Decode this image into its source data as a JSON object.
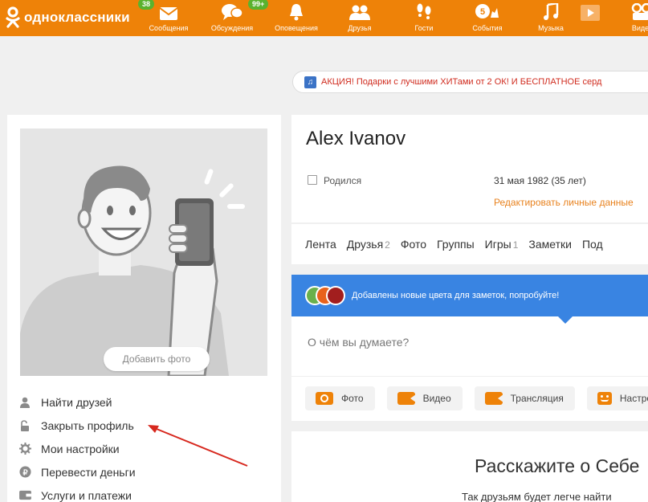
{
  "brand": {
    "name": "одноклассники",
    "accent": "#ee8208"
  },
  "nav": [
    {
      "label": "Сообщения",
      "badge": "38",
      "icon": "envelope-icon"
    },
    {
      "label": "Обсуждения",
      "badge": "99+",
      "icon": "chat-bubbles-icon"
    },
    {
      "label": "Оповещения",
      "badge": "",
      "icon": "bell-icon"
    },
    {
      "label": "Друзья",
      "badge": "",
      "icon": "people-icon"
    },
    {
      "label": "Гости",
      "badge": "",
      "icon": "footprints-icon"
    },
    {
      "label": "События",
      "badge": "",
      "icon": "events-icon"
    },
    {
      "label": "Музыка",
      "badge": "",
      "icon": "music-note-icon"
    },
    {
      "label": "",
      "badge": "",
      "icon": "play-icon"
    },
    {
      "label": "Видео",
      "badge": "",
      "icon": "video-icon"
    }
  ],
  "promo": {
    "text": "АКЦИЯ! Подарки с лучшими ХИТами от 2 ОК! И БЕСПЛАТНОЕ серд"
  },
  "left": {
    "add_photo": "Добавить фото",
    "menu": [
      {
        "label": "Найти друзей",
        "icon": "person-icon"
      },
      {
        "label": "Закрыть профиль",
        "icon": "unlock-icon"
      },
      {
        "label": "Мои настройки",
        "icon": "gear-icon"
      },
      {
        "label": "Перевести деньги",
        "icon": "money-transfer-icon"
      },
      {
        "label": "Услуги и платежи",
        "icon": "wallet-icon"
      }
    ]
  },
  "profile": {
    "name": "Alex Ivanov",
    "born_label": "Родился",
    "born_value": "31 мая 1982 (35 лет)",
    "edit_link": "Редактировать личные данные"
  },
  "tabs": [
    {
      "label": "Лента",
      "count": ""
    },
    {
      "label": "Друзья",
      "count": "2"
    },
    {
      "label": "Фото",
      "count": ""
    },
    {
      "label": "Группы",
      "count": ""
    },
    {
      "label": "Игры",
      "count": "1"
    },
    {
      "label": "Заметки",
      "count": ""
    },
    {
      "label": "Под",
      "count": ""
    }
  ],
  "post": {
    "banner": "Добавлены новые цвета для заметок, попробуйте!",
    "placeholder": "О чём вы думаете?",
    "actions": [
      "Фото",
      "Видео",
      "Трансляция",
      "Настро"
    ]
  },
  "about": {
    "title": "Расскажите о Себе",
    "subtitle": "Так друзьям будет легче найти"
  }
}
